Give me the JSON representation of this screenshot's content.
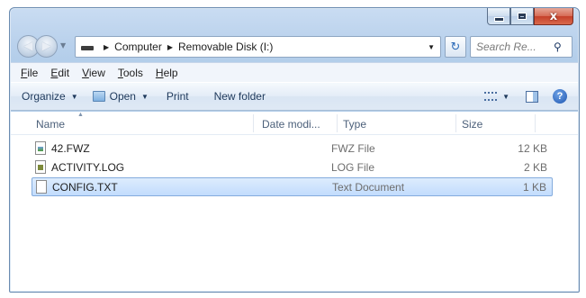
{
  "caption": {
    "minimize": "—",
    "maximize": "□",
    "close": "x"
  },
  "nav": {
    "breadcrumb": [
      "Computer",
      "Removable Disk (I:)"
    ],
    "search_placeholder": "Search Re..."
  },
  "menu": [
    {
      "key": "F",
      "rest": "ile"
    },
    {
      "key": "E",
      "rest": "dit"
    },
    {
      "key": "V",
      "rest": "iew"
    },
    {
      "key": "T",
      "rest": "ools"
    },
    {
      "key": "H",
      "rest": "elp"
    }
  ],
  "toolbar": {
    "organize": "Organize",
    "open": "Open",
    "print": "Print",
    "new_folder": "New folder"
  },
  "columns": {
    "name": "Name",
    "date": "Date modi...",
    "type": "Type",
    "size": "Size"
  },
  "files": [
    {
      "name": "42.FWZ",
      "type": "FWZ File",
      "size": "12 KB",
      "icon": "image-file-icon"
    },
    {
      "name": "ACTIVITY.LOG",
      "type": "LOG File",
      "size": "2 KB",
      "icon": "log-file-icon"
    },
    {
      "name": "CONFIG.TXT",
      "type": "Text Document",
      "size": "1 KB",
      "icon": "text-file-icon"
    }
  ]
}
